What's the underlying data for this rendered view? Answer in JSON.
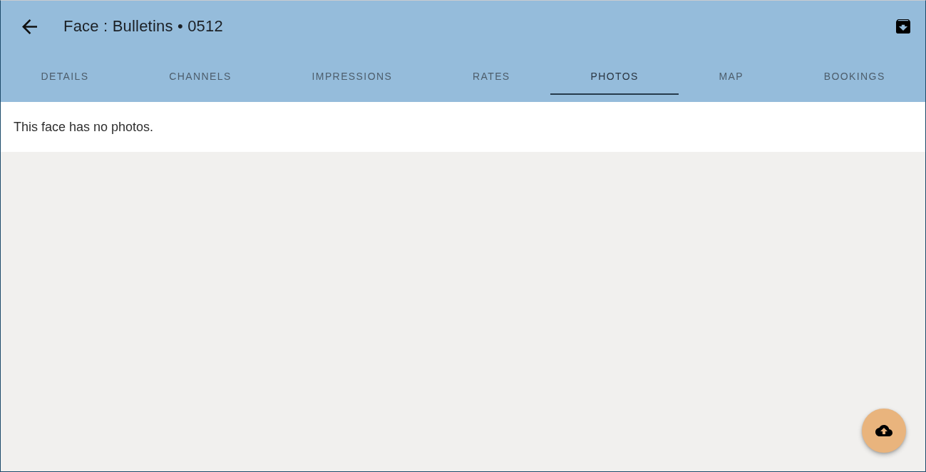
{
  "app_bar": {
    "title": "Face : Bulletins • 0512"
  },
  "tabs": [
    {
      "label": "DETAILS",
      "selected": false
    },
    {
      "label": "CHANNELS",
      "selected": false
    },
    {
      "label": "IMPRESSIONS",
      "selected": false
    },
    {
      "label": "RATES",
      "selected": false
    },
    {
      "label": "PHOTOS",
      "selected": true
    },
    {
      "label": "MAP",
      "selected": false
    },
    {
      "label": "BOOKINGS",
      "selected": false
    }
  ],
  "content": {
    "message": "This face has no photos."
  }
}
